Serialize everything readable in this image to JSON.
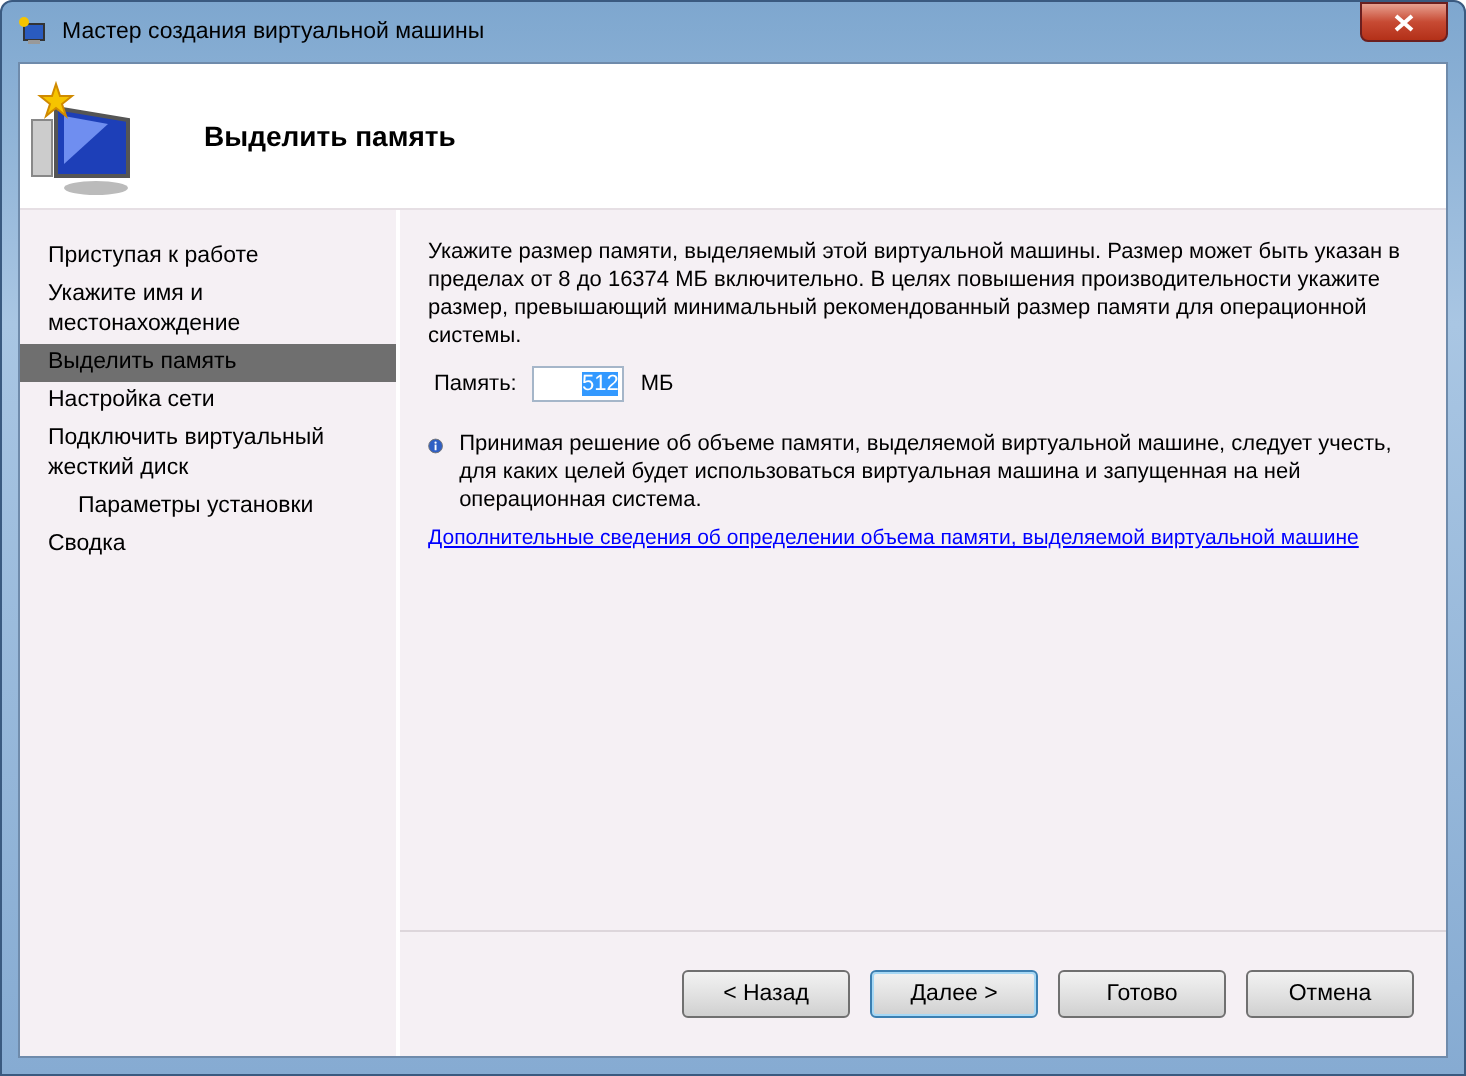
{
  "window": {
    "title": "Мастер создания виртуальной машины"
  },
  "header": {
    "title": "Выделить память"
  },
  "steps": [
    {
      "label": "Приступая к работе",
      "selected": false
    },
    {
      "label": "Укажите имя и местонахождение",
      "selected": false
    },
    {
      "label": "Выделить память",
      "selected": true
    },
    {
      "label": "Настройка сети",
      "selected": false
    },
    {
      "label": "Подключить виртуальный жесткий диск",
      "selected": false,
      "children": [
        {
          "label": "Параметры установки",
          "selected": false
        }
      ]
    },
    {
      "label": "Сводка",
      "selected": false
    }
  ],
  "description": "Укажите размер памяти, выделяемый этой виртуальной машины. Размер может быть указан в пределах от 8 до 16374 МБ включительно. В целях повышения производительности укажите размер, превышающий минимальный рекомендованный размер памяти для операционной системы.",
  "memory": {
    "label": "Память:",
    "value": "512",
    "text_selected": true,
    "unit": "МБ"
  },
  "info": "Принимая решение об объеме памяти, выделяемой виртуальной машине, следует учесть, для каких целей будет использоваться виртуальная машина и запущенная на ней операционная система.",
  "link": "Дополнительные сведения об определении объема памяти, выделяемой виртуальной машине",
  "buttons": [
    {
      "label": "< Назад",
      "default": false
    },
    {
      "label": "Далее >",
      "default": true
    },
    {
      "label": "Готово",
      "default": false
    },
    {
      "label": "Отмена",
      "default": false
    }
  ]
}
